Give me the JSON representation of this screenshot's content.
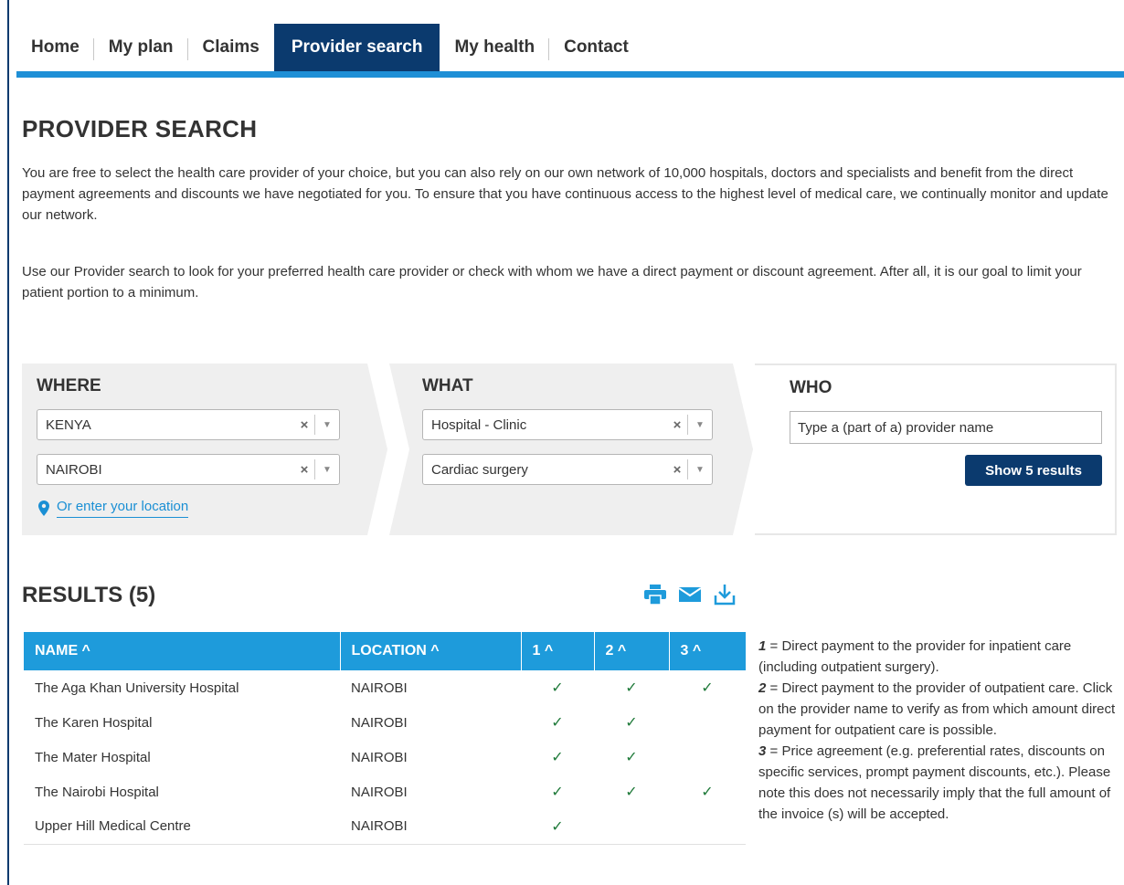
{
  "nav": {
    "items": [
      {
        "label": "Home",
        "active": false
      },
      {
        "label": "My plan",
        "active": false
      },
      {
        "label": "Claims",
        "active": false
      },
      {
        "label": "Provider search",
        "active": true
      },
      {
        "label": "My health",
        "active": false
      },
      {
        "label": "Contact",
        "active": false
      }
    ]
  },
  "page": {
    "title": "PROVIDER SEARCH",
    "paragraph1": "You are free to select the health care provider of your choice, but you can also rely on our own network of 10,000 hospitals, doctors and specialists and benefit from the direct payment agreements and discounts we have negotiated for you. To ensure that you have continuous access to the highest level of medical care, we continually monitor and update our network.",
    "paragraph2": "Use our Provider search to look for your preferred health care provider or check with whom we have a direct payment or discount agreement. After all, it is our goal to limit your patient portion to a minimum."
  },
  "search": {
    "where": {
      "heading": "WHERE",
      "country": "KENYA",
      "city": "NAIROBI",
      "location_link": "Or enter your location"
    },
    "what": {
      "heading": "WHAT",
      "type": "Hospital - Clinic",
      "specialty": "Cardiac surgery"
    },
    "who": {
      "heading": "WHO",
      "placeholder": "Type a (part of a) provider name",
      "button": "Show 5 results"
    },
    "clear_glyph": "×",
    "arrow_glyph": "▼"
  },
  "results": {
    "title": "RESULTS (5)",
    "columns": [
      "NAME ^",
      "LOCATION ^",
      "1 ^",
      "2 ^",
      "3 ^"
    ],
    "check_glyph": "✓",
    "rows": [
      {
        "name": "The Aga Khan University Hospital",
        "location": "NAIROBI",
        "c1": true,
        "c2": true,
        "c3": true
      },
      {
        "name": "The Karen Hospital",
        "location": "NAIROBI",
        "c1": true,
        "c2": true,
        "c3": false
      },
      {
        "name": "The Mater Hospital",
        "location": "NAIROBI",
        "c1": true,
        "c2": true,
        "c3": false
      },
      {
        "name": "The Nairobi Hospital",
        "location": "NAIROBI",
        "c1": true,
        "c2": true,
        "c3": true
      },
      {
        "name": "Upper Hill Medical Centre",
        "location": "NAIROBI",
        "c1": true,
        "c2": false,
        "c3": false
      }
    ]
  },
  "legend": {
    "l1_key": "1",
    "l1_text": " = Direct payment to the provider for inpatient care (including outpatient surgery).",
    "l2_key": "2",
    "l2_text": " = Direct payment to the provider of outpatient care. Click on the provider name to verify as from which amount direct payment for outpatient care is possible.",
    "l3_key": "3",
    "l3_text": " = Price agreement (e.g. preferential rates, discounts on specific services, prompt payment discounts, etc.). Please note this does not necessarily imply that the full amount of the invoice (s) will be accepted."
  },
  "colors": {
    "nav_active": "#0b3a6e",
    "accent_bar": "#1e8fd6",
    "table_header": "#1e9bdb",
    "check": "#1f7a3a",
    "link": "#1a8fd4"
  }
}
